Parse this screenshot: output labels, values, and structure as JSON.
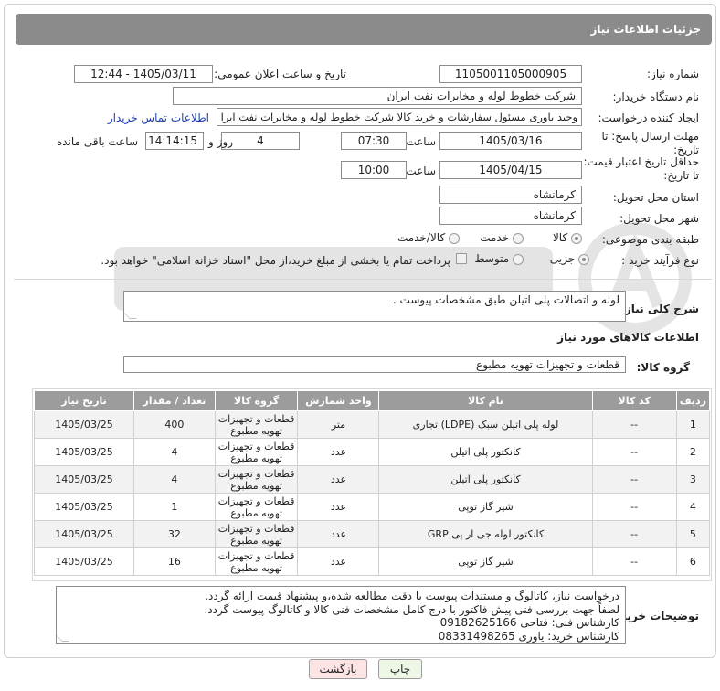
{
  "header": {
    "title": "جزئیات اطلاعات نیاز"
  },
  "fields": {
    "need_number_label": "شماره نیاز:",
    "need_number": "1105001105000905",
    "announce_label": "تاریخ و ساعت اعلان عمومی:",
    "announce_value": "1405/03/11 - 12:44",
    "buyer_label": "نام دستگاه خریدار:",
    "buyer_value": "شرکت خطوط لوله و مخابرات نفت ایران",
    "creator_label": "ایجاد کننده درخواست:",
    "creator_value": "وحید یاوری مسئول سفارشات و خرید کالا  شرکت خطوط لوله و مخابرات نفت ایرا",
    "contact_link": "اطلاعات تماس خریدار",
    "deadline_label_1": "مهلت ارسال پاسخ: تا",
    "deadline_label_2": "تاریخ:",
    "deadline_date": "1405/03/16",
    "time_label": "ساعت",
    "deadline_time": "07:30",
    "days_value": "4",
    "days_label": "روز و",
    "remaining_time": "14:14:15",
    "remaining_label": "ساعت باقی مانده",
    "validity_label_1": "حداقل تاریخ اعتبار قیمت:",
    "validity_label_2": "تا تاریخ:",
    "validity_date": "1405/04/15",
    "validity_time": "10:00",
    "province_label": "استان محل تحویل:",
    "province_value": "کرمانشاه",
    "city_label": "شهر محل تحویل:",
    "city_value": "کرمانشاه",
    "category_label": "طبقه بندی موضوعی:",
    "category_options": [
      "کالا",
      "خدمت",
      "کالا/خدمت"
    ],
    "category_selected": "کالا",
    "process_label": "نوع فرآیند خرید :",
    "process_options": [
      "جزیی",
      "متوسط"
    ],
    "process_selected": "جزیی",
    "payment_note": "پرداخت تمام یا بخشی از مبلغ خرید،از محل \"اسناد خزانه اسلامی\" خواهد بود."
  },
  "description": {
    "label": "شرح کلی نیاز:",
    "value": "لوله و اتصالات پلی اتیلن طبق مشخصات پیوست ."
  },
  "goods": {
    "section_title": "اطلاعات کالاهای مورد نیاز",
    "group_label": "گروه کالا:",
    "group_value": "قطعات و تجهیزات تهویه مطبوع"
  },
  "table": {
    "headers": [
      "ردیف",
      "کد کالا",
      "نام کالا",
      "واحد شمارش",
      "گروه کالا",
      "تعداد / مقدار",
      "تاریخ نیاز"
    ],
    "rows": [
      {
        "row": "1",
        "code": "--",
        "name": "لوله پلی اتیلن سبک (LDPE) تجاری",
        "unit": "متر",
        "group": "قطعات و تجهیزات تهویه مطبوع",
        "qty": "400",
        "date": "1405/03/25"
      },
      {
        "row": "2",
        "code": "--",
        "name": "کانکتور پلی اتیلن",
        "unit": "عدد",
        "group": "قطعات و تجهیزات تهویه مطبوع",
        "qty": "4",
        "date": "1405/03/25"
      },
      {
        "row": "3",
        "code": "--",
        "name": "کانکتور پلی اتیلن",
        "unit": "عدد",
        "group": "قطعات و تجهیزات تهویه مطبوع",
        "qty": "4",
        "date": "1405/03/25"
      },
      {
        "row": "4",
        "code": "--",
        "name": "شیر گاز توپی",
        "unit": "عدد",
        "group": "قطعات و تجهیزات تهویه مطبوع",
        "qty": "1",
        "date": "1405/03/25"
      },
      {
        "row": "5",
        "code": "--",
        "name": "کانکتور لوله جی ار پی GRP",
        "unit": "عدد",
        "group": "قطعات و تجهیزات تهویه مطبوع",
        "qty": "32",
        "date": "1405/03/25"
      },
      {
        "row": "6",
        "code": "--",
        "name": "شیر گاز توپی",
        "unit": "عدد",
        "group": "قطعات و تجهیزات تهویه مطبوع",
        "qty": "16",
        "date": "1405/03/25"
      }
    ]
  },
  "buyer_notes": {
    "label": "توضیحات خریدار:",
    "lines": [
      "درخواست نیاز، کاتالوگ و مستندات پیوست با دقت مطالعه شده،و پیشنهاد قیمت ارائه گردد.",
      "لطفاً جهت بررسی فنی  پیش فاکتور با درج کامل مشخصات فنی کالا و کاتالوگ پیوست گردد.",
      "کارشناس فنی: فتاحی 09182625166",
      "کارشناس خرید: یاوری  08331498265"
    ]
  },
  "buttons": {
    "print": "چاپ",
    "back": "بازگشت"
  },
  "colors": {
    "header_bg": "#8b8b8b",
    "table_header_bg": "#9c9c9c",
    "back_button_bg": "#fde4e4",
    "print_button_bg": "#eef7e6"
  }
}
